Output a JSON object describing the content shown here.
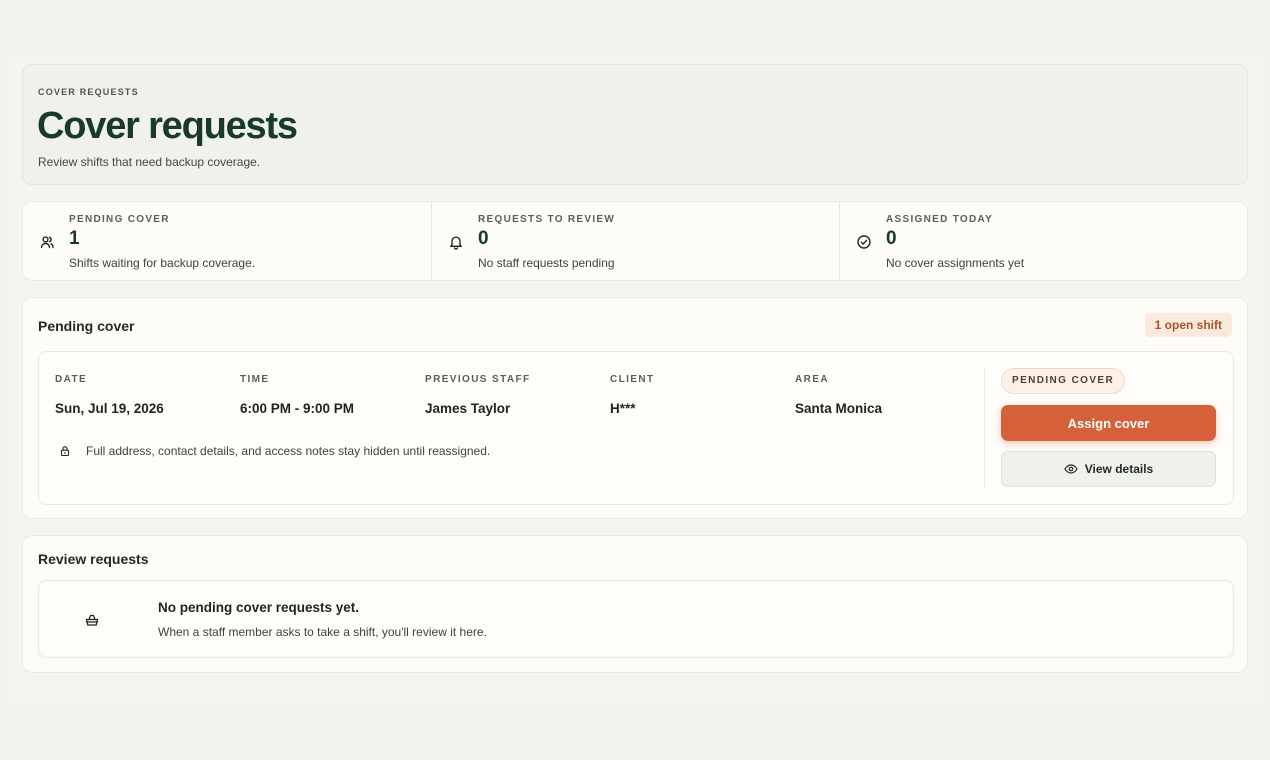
{
  "header": {
    "eyebrow": "COVER REQUESTS",
    "title": "Cover requests",
    "subtitle": "Review shifts that need backup coverage."
  },
  "stats": [
    {
      "label": "PENDING COVER",
      "value": "1",
      "desc": "Shifts waiting for backup coverage.",
      "icon": "people-icon"
    },
    {
      "label": "REQUESTS TO REVIEW",
      "value": "0",
      "desc": "No staff requests pending",
      "icon": "bell-icon"
    },
    {
      "label": "ASSIGNED TODAY",
      "value": "0",
      "desc": "No cover assignments yet",
      "icon": "check-circle-icon"
    }
  ],
  "pending": {
    "title": "Pending cover",
    "badge": "1 open shift",
    "shift": {
      "fields": [
        {
          "label": "DATE",
          "value": "Sun, Jul 19, 2026"
        },
        {
          "label": "TIME",
          "value": "6:00 PM - 9:00 PM"
        },
        {
          "label": "PREVIOUS STAFF",
          "value": "James Taylor"
        },
        {
          "label": "CLIENT",
          "value": "H***"
        },
        {
          "label": "AREA",
          "value": "Santa Monica"
        }
      ],
      "privacy_note": "Full address, contact details, and access notes stay hidden until reassigned.",
      "status": "PENDING COVER",
      "assign_label": "Assign cover",
      "view_label": "View details"
    }
  },
  "review": {
    "title": "Review requests",
    "empty_title": "No pending cover requests yet.",
    "empty_desc": "When a staff member asks to take a shift, you'll review it here."
  },
  "colors": {
    "accent": "#d6603a",
    "heading": "#17392e",
    "background": "#f4f2ed"
  }
}
